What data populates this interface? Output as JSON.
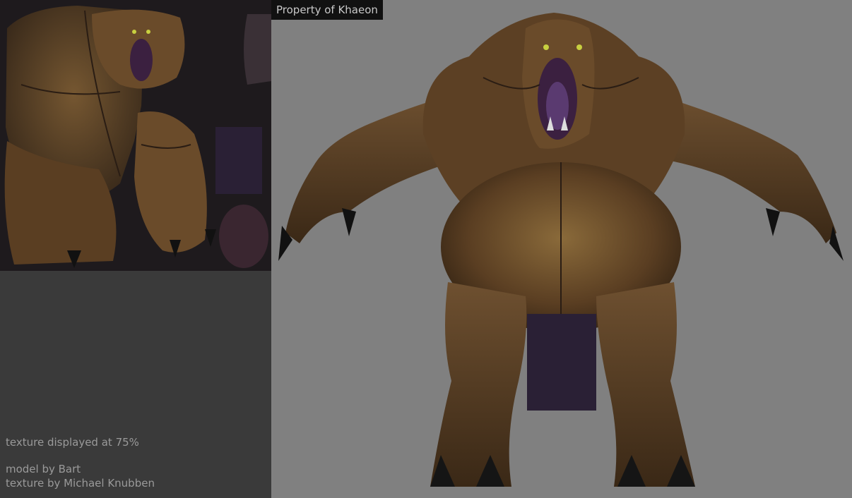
{
  "viewport": {
    "property_label": "Property of Khaeon",
    "background_color": "#808080",
    "model_subject": "brown-ape-like-monster-model"
  },
  "texture_panel": {
    "background_color": "#3a3a3a",
    "texture_note": "texture displayed at 75%",
    "model_credit": "model by Bart",
    "texture_credit": "texture by Michael Knubben"
  },
  "colors": {
    "skin": "#5a3e22",
    "skin_highlight": "#7a5a32",
    "shadow": "#2a1d14",
    "loincloth": "#2a2035",
    "mouth": "#3b2040",
    "eyes": "#c8d040"
  }
}
